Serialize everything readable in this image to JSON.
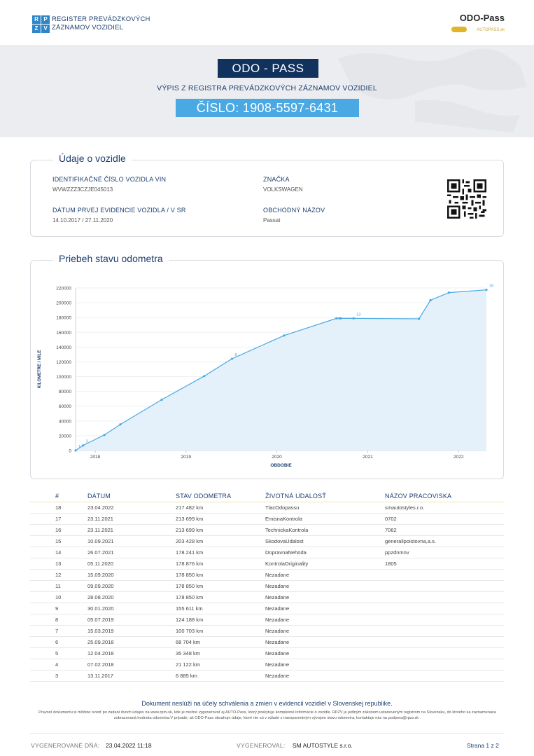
{
  "header": {
    "rpzv_letters": [
      "R",
      "P",
      "Z",
      "V"
    ],
    "register_title_line1": "REGISTER PREVÁDZKOVÝCH",
    "register_title_line2": "ZÁZNAMOV VOZIDIEL",
    "logo_text": "ODO-Pass",
    "logo_tagline": "AUTOPASS.sk"
  },
  "banner": {
    "title": "ODO - PASS",
    "subtitle": "VÝPIS Z REGISTRA PREVÁDZKOVÝCH ZÁZNAMOV VOZIDIEL",
    "number": "ČÍSLO: 1908-5597-6431"
  },
  "vehicle": {
    "section_title": "Údaje o vozidle",
    "vin_label": "IDENTIFIKAČNÉ ČÍSLO VOZIDLA VIN",
    "vin_value": "WVWZZZ3CZJE045013",
    "first_reg_label": "DÁTUM PRVEJ EVIDENCIE VOZIDLA / V SR",
    "first_reg_value": "14.10.2017 / 27.11.2020",
    "brand_label": "ZNAČKA",
    "brand_value": "VOLKSWAGEN",
    "trade_name_label": "OBCHODNÝ NÁZOV",
    "trade_name_value": "Passat"
  },
  "chart_section_title": "Priebeh stavu odometra",
  "chart_data": {
    "type": "area",
    "xlabel": "OBDOBIE",
    "ylabel": "KILOMETRE / MILE",
    "ylim": [
      0,
      220000
    ],
    "yticks": [
      0,
      20000,
      40000,
      60000,
      80000,
      100000,
      120000,
      140000,
      160000,
      180000,
      200000,
      220000
    ],
    "xticks": [
      "2018",
      "2019",
      "2020",
      "2021",
      "2022"
    ],
    "x_range": [
      "2017-10-14",
      "2022-04-23"
    ],
    "line_color": "#4aa8e3",
    "fill_color": "#e4f1fa",
    "points": [
      {
        "date": "2017-10-14",
        "km": 0,
        "label": "1"
      },
      {
        "date": "2017-11-13",
        "km": 6885,
        "label": "3"
      },
      {
        "date": "2018-02-07",
        "km": 21122,
        "label": ""
      },
      {
        "date": "2018-04-12",
        "km": 35348,
        "label": ""
      },
      {
        "date": "2018-09-25",
        "km": 68704,
        "label": ""
      },
      {
        "date": "2019-03-15",
        "km": 100703,
        "label": ""
      },
      {
        "date": "2019-07-05",
        "km": 124188,
        "label": "8"
      },
      {
        "date": "2020-01-30",
        "km": 155611,
        "label": ""
      },
      {
        "date": "2020-08-28",
        "km": 178850,
        "label": ""
      },
      {
        "date": "2020-09-09",
        "km": 178850,
        "label": ""
      },
      {
        "date": "2020-09-15",
        "km": 178850,
        "label": ""
      },
      {
        "date": "2020-11-05",
        "km": 178876,
        "label": "13"
      },
      {
        "date": "2021-07-26",
        "km": 178241,
        "label": ""
      },
      {
        "date": "2021-09-10",
        "km": 203428,
        "label": ""
      },
      {
        "date": "2021-11-23",
        "km": 213699,
        "label": ""
      },
      {
        "date": "2022-04-23",
        "km": 217482,
        "label": "18"
      }
    ]
  },
  "table": {
    "headers": [
      "#",
      "DÁTUM",
      "STAV ODOMETRA",
      "ŽIVOTNÁ UDALOSŤ",
      "NÁZOV PRACOVISKA"
    ],
    "rows": [
      [
        "18",
        "23.04.2022",
        "217 482 km",
        "TlacOdopassu",
        "smautostyles.r.o."
      ],
      [
        "17",
        "23.11.2021",
        "213 699 km",
        "EmisnaKontrola",
        "0702"
      ],
      [
        "16",
        "23.11.2021",
        "213 699 km",
        "TechnickaKontrola",
        "7062"
      ],
      [
        "15",
        "10.09.2021",
        "203 428 km",
        "SkodovaUdalost",
        "generalipoistovna,a.s."
      ],
      [
        "14",
        "26.07.2021",
        "178 241 km",
        "DopravnaNehoda",
        "ppzdnmnv"
      ],
      [
        "13",
        "05.11.2020",
        "178 876 km",
        "KontrolaOriginality",
        "1805"
      ],
      [
        "12",
        "15.09.2020",
        "178 850 km",
        "Nezadane",
        ""
      ],
      [
        "11",
        "09.09.2020",
        "178 850 km",
        "Nezadane",
        ""
      ],
      [
        "10",
        "28.08.2020",
        "178 850 km",
        "Nezadane",
        ""
      ],
      [
        "9",
        "30.01.2020",
        "155 611 km",
        "Nezadane",
        ""
      ],
      [
        "8",
        "05.07.2019",
        "124 188 km",
        "Nezadane",
        ""
      ],
      [
        "7",
        "15.03.2019",
        "100 703 km",
        "Nezadane",
        ""
      ],
      [
        "6",
        "25.09.2018",
        "68 704 km",
        "Nezadane",
        ""
      ],
      [
        "5",
        "12.04.2018",
        "35 348 km",
        "Nezadane",
        ""
      ],
      [
        "4",
        "07.02.2018",
        "21 122 km",
        "Nezadane",
        ""
      ],
      [
        "3",
        "13.11.2017",
        "6 885 km",
        "Nezadane",
        ""
      ]
    ]
  },
  "notes": {
    "main": "Dokument neslúži na účely schválenia a zmien v evidencii vozidiel v Slovenskej republike.",
    "small": "Pravosť dokumentu si môžete overiť po zadaní dvoch údajov na www.rpzv.sk, kde je možné vygenerovať aj AUTO-Pass, ktorý poskytuje komplexné informácie o vozidle. RPZV je jediným zákonom ustanoveným registrom na Slovensku, do ktorého sa zaznamenáva zobrazovaná hodnota odometra.V prípade, ak ODO-Pass obsahuje údaje, ktoré nie sú v súlade s transparentným vývojom stavu odometra, kontaktuje nás na podpora@rpzv.sk ."
  },
  "footer": {
    "generated_on_label": "VYGENEROVANÉ DŇA:",
    "generated_on_value": "23.04.2022  11:18",
    "generated_by_label": "VYGENEROVAL:",
    "generated_by_value": "SM AUTOSTYLE s.r.o.",
    "page": "Strana 1 z 2"
  }
}
